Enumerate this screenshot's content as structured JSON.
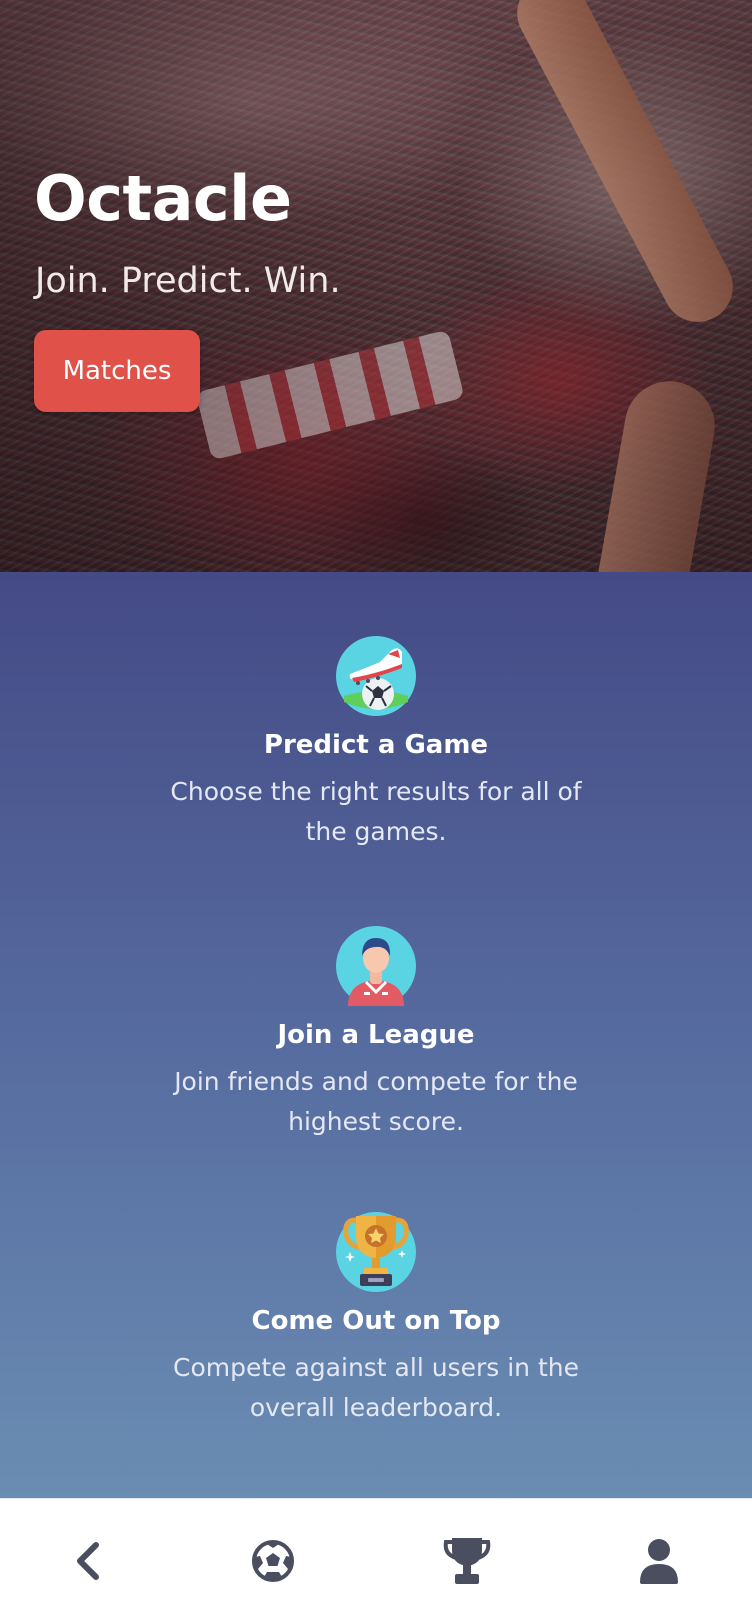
{
  "app": {
    "title": "Octacle",
    "tagline": "Join. Predict. Win.",
    "primary_action": "Matches",
    "accent_color": "#e05149"
  },
  "features": [
    {
      "icon": "soccer-boot-ball-icon",
      "title": "Predict a Game",
      "description": "Choose the right results for all of the games."
    },
    {
      "icon": "player-avatar-icon",
      "title": "Join a League",
      "description": "Join friends and compete for the highest score."
    },
    {
      "icon": "trophy-icon",
      "title": "Come Out on Top",
      "description": "Compete against all users in the overall leaderboard."
    }
  ],
  "bottom_nav": {
    "items": [
      {
        "icon": "back-chevron-icon"
      },
      {
        "icon": "soccer-ball-icon"
      },
      {
        "icon": "trophy-icon"
      },
      {
        "icon": "user-icon"
      }
    ],
    "icon_color": "#4a4e5e"
  }
}
